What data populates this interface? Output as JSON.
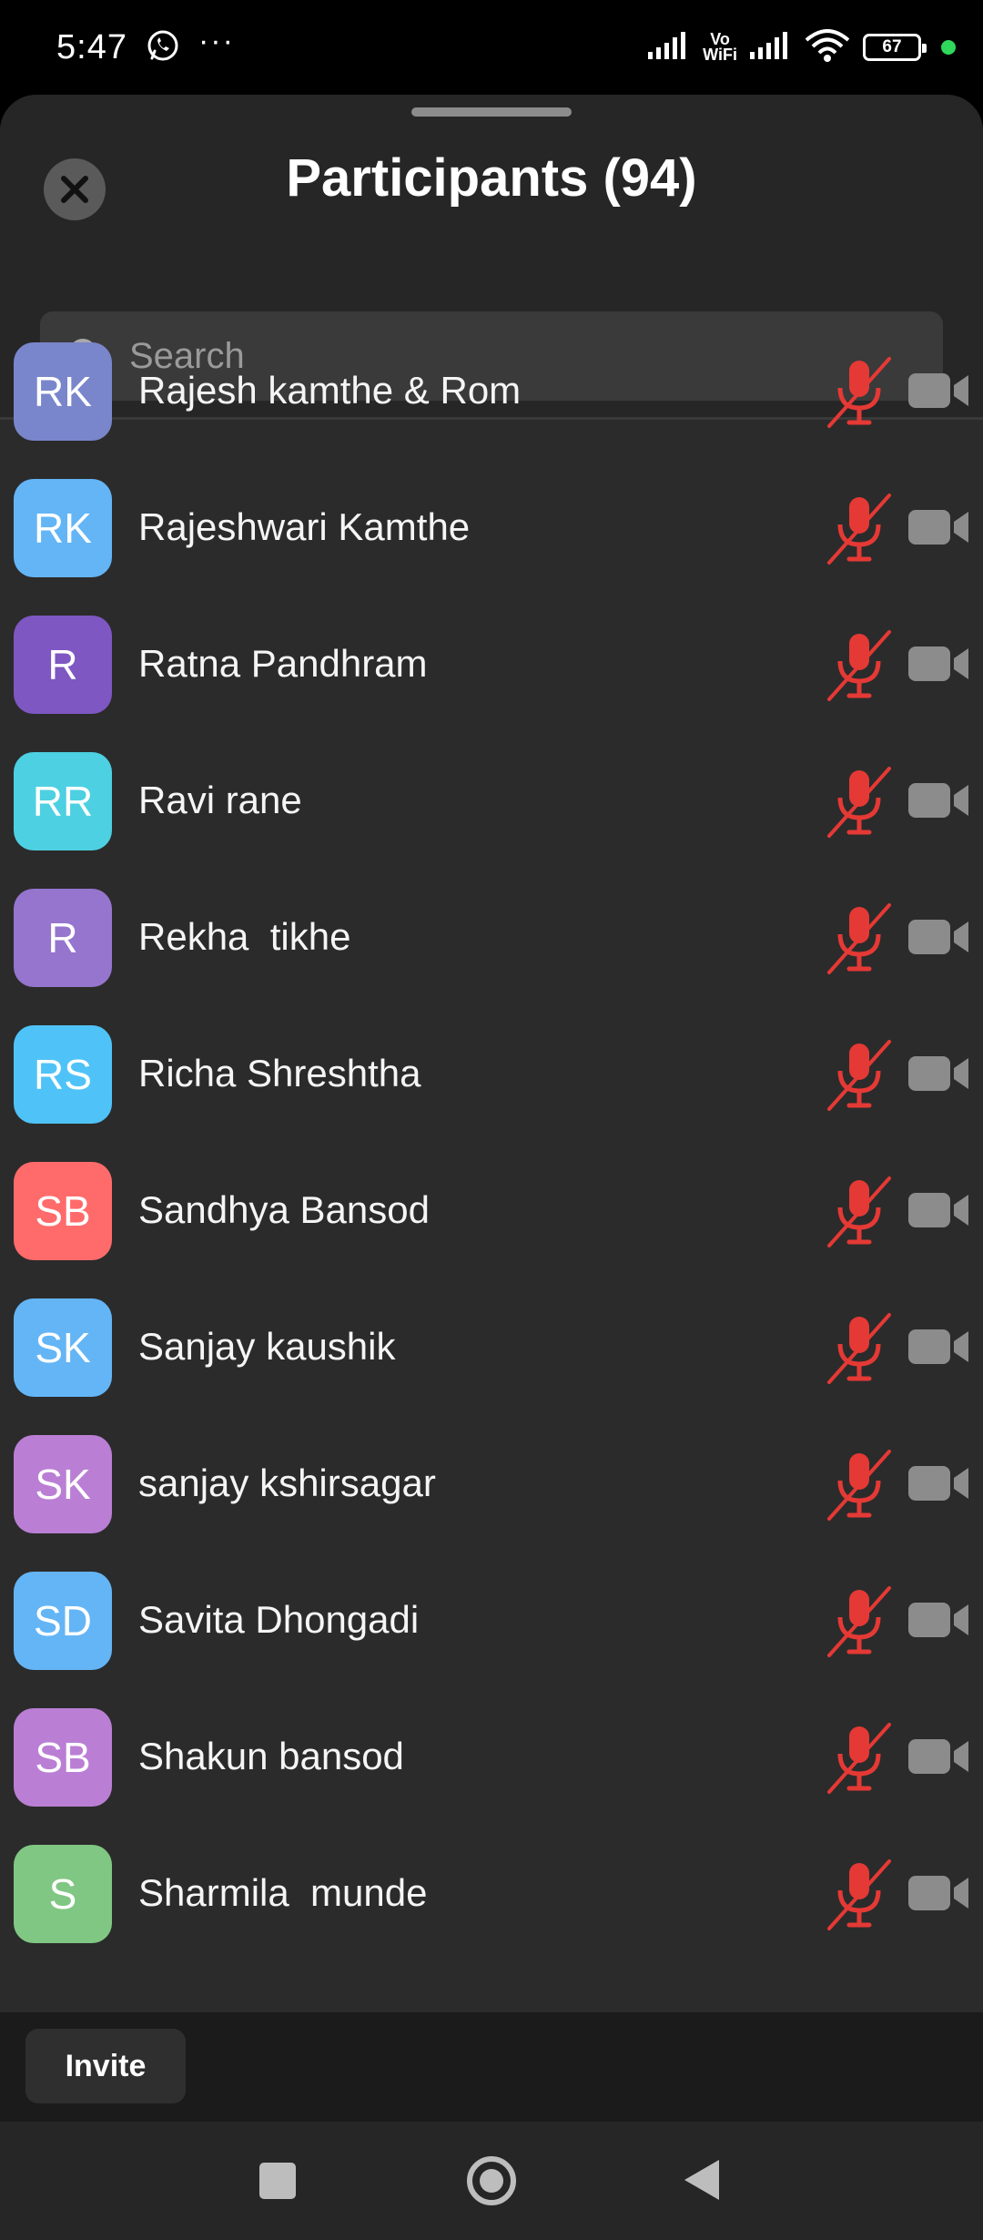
{
  "status_bar": {
    "time": "5:47",
    "extra": "···",
    "vowifi_top": "Vo",
    "vowifi_bottom": "WiFi",
    "battery": "67"
  },
  "header": {
    "title": "Participants (94)"
  },
  "search": {
    "placeholder": "Search"
  },
  "participants": [
    {
      "initials": "RK",
      "name": "Rajesh kamthe & Rom",
      "color": "#7986CB"
    },
    {
      "initials": "RK",
      "name": "Rajeshwari Kamthe",
      "color": "#64B5F6"
    },
    {
      "initials": "R",
      "name": "Ratna Pandhram",
      "color": "#7E57C2"
    },
    {
      "initials": "RR",
      "name": "Ravi rane",
      "color": "#4DD0E1"
    },
    {
      "initials": "R",
      "name": "Rekha  tikhe",
      "color": "#9575CD"
    },
    {
      "initials": "RS",
      "name": "Richa Shreshtha",
      "color": "#4FC3F7"
    },
    {
      "initials": "SB",
      "name": "Sandhya Bansod",
      "color": "#FF6B6B"
    },
    {
      "initials": "SK",
      "name": "Sanjay kaushik",
      "color": "#64B5F6"
    },
    {
      "initials": "SK",
      "name": "sanjay kshirsagar",
      "color": "#BA7FD4"
    },
    {
      "initials": "SD",
      "name": "Savita Dhongadi",
      "color": "#64B5F6"
    },
    {
      "initials": "SB",
      "name": "Shakun bansod",
      "color": "#BA7FD4"
    },
    {
      "initials": "S",
      "name": "Sharmila  munde",
      "color": "#81C784"
    }
  ],
  "icons": {
    "mic": "mic-muted-icon",
    "camera": "video-camera-icon",
    "mic_color": "#E53935",
    "camera_color": "#8C8C8C"
  },
  "footer": {
    "invite_label": "Invite"
  }
}
